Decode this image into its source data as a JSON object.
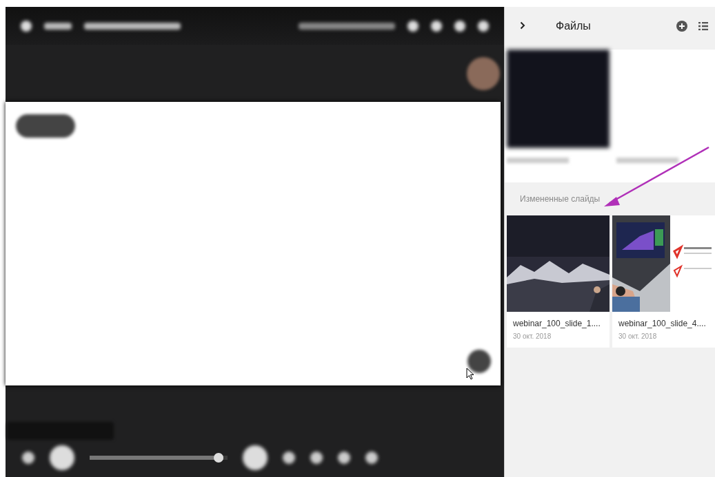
{
  "player": {
    "level": 0.97
  },
  "panel": {
    "title": "Файлы"
  },
  "section": {
    "label": "Измененные слайды"
  },
  "files": [
    {
      "name": "webinar_100_slide_1....",
      "date": "30 окт. 2018",
      "kind": "night"
    },
    {
      "name": "webinar_100_slide_4....",
      "date": "30 окт. 2018",
      "kind": "laptop"
    }
  ]
}
